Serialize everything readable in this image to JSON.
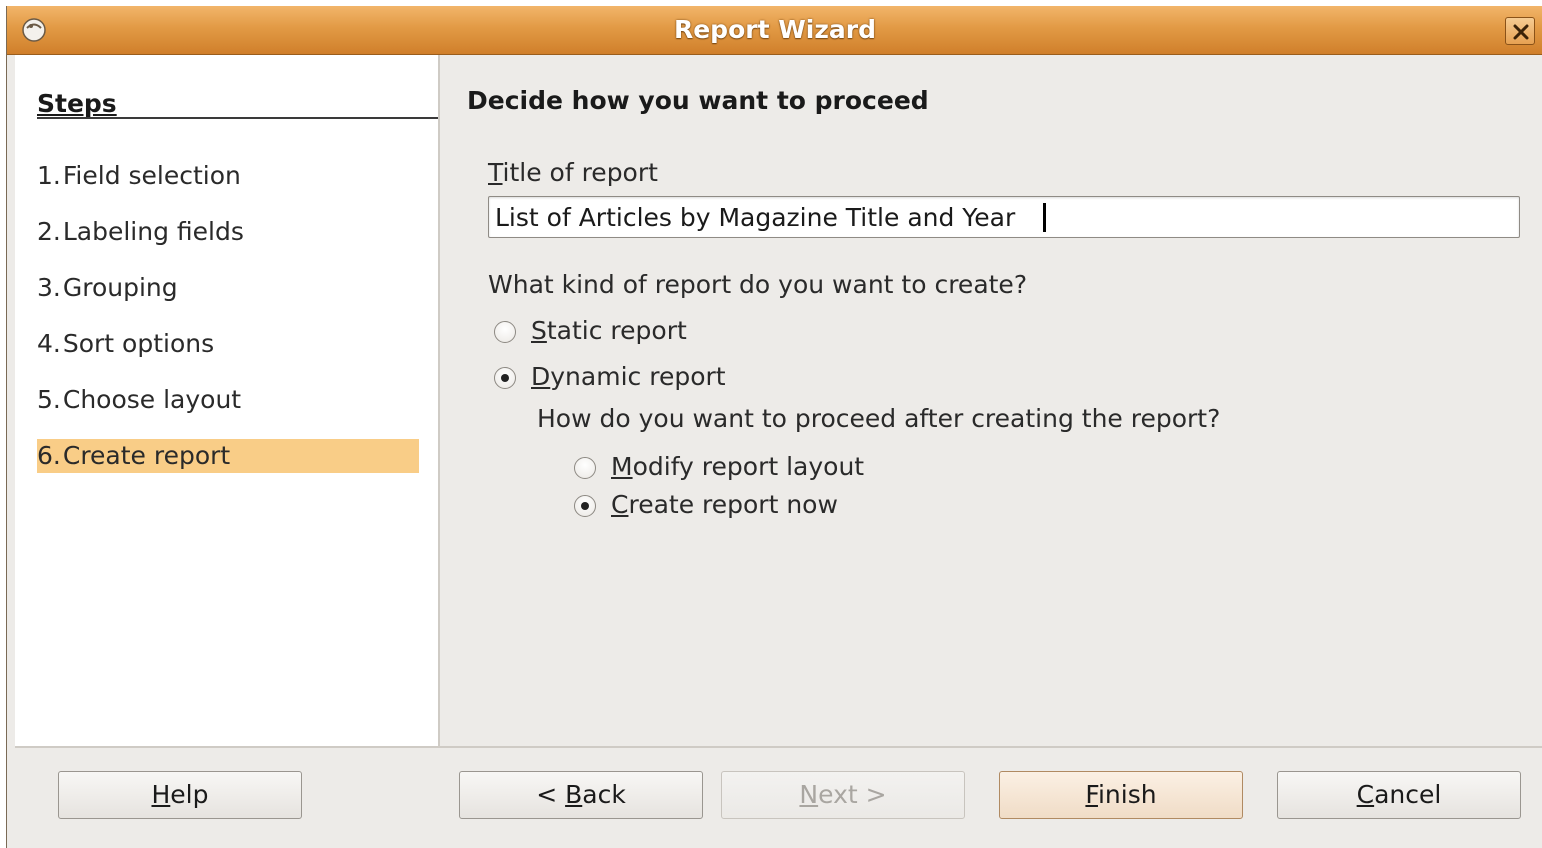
{
  "window": {
    "title": "Report Wizard"
  },
  "steps": {
    "heading": "Steps",
    "items": [
      {
        "num": "1.",
        "label": "Field selection",
        "active": false
      },
      {
        "num": "2.",
        "label": "Labeling fields",
        "active": false
      },
      {
        "num": "3.",
        "label": "Grouping",
        "active": false
      },
      {
        "num": "4.",
        "label": "Sort options",
        "active": false
      },
      {
        "num": "5.",
        "label": "Choose layout",
        "active": false
      },
      {
        "num": "6.",
        "label": "Create report",
        "active": true
      }
    ]
  },
  "main": {
    "heading": "Decide how you want to proceed",
    "title_label_mn": "T",
    "title_label_rest": "itle of report",
    "title_value": "List of Articles by Magazine Title and Year",
    "kind_question": "What kind of report do you want to create?",
    "static": {
      "mn": "S",
      "rest": "tatic report",
      "checked": false
    },
    "dynamic": {
      "mn": "D",
      "rest": "ynamic report",
      "checked": true
    },
    "proceed_question": "How do you want to proceed after creating the report?",
    "modify": {
      "mn": "M",
      "rest": "odify report layout",
      "checked": false
    },
    "create_now": {
      "mn": "C",
      "rest": "reate report now",
      "checked": true
    }
  },
  "buttons": {
    "help": {
      "mn": "H",
      "rest": "elp"
    },
    "back": {
      "pre": "< ",
      "mn": "B",
      "rest": "ack"
    },
    "next": {
      "mn": "N",
      "rest": "ext >",
      "disabled": true
    },
    "finish": {
      "mn": "F",
      "rest": "inish"
    },
    "cancel": {
      "mn": "C",
      "rest": "ancel"
    }
  },
  "colors": {
    "titlebar": "#e29a45",
    "active_step": "#f9cd87",
    "window_bg": "#edebe8"
  }
}
